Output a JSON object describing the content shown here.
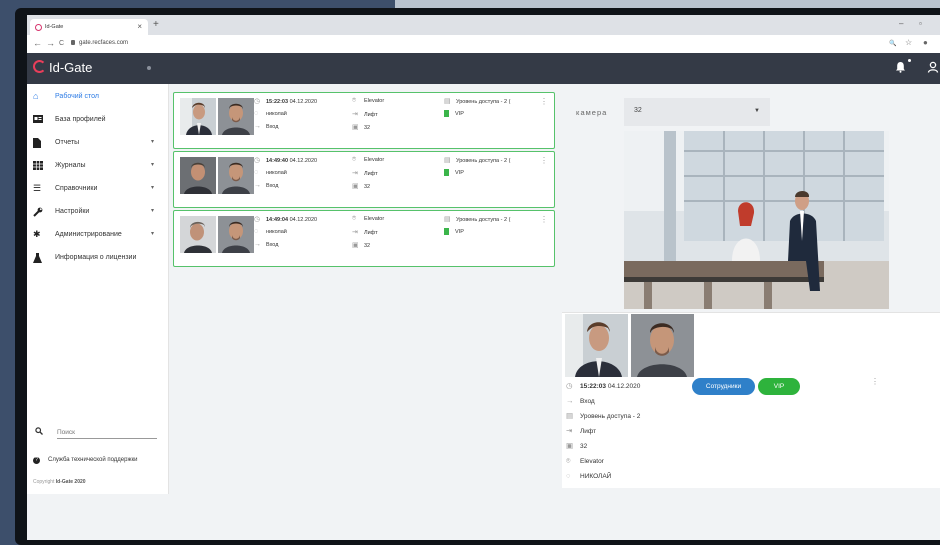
{
  "browser": {
    "tab_title": "Id-Gate",
    "tab_close": "×",
    "new_tab": "+",
    "url": "gate.recfaces.com",
    "nav_back": "←",
    "nav_forward": "→",
    "nav_reload": "C",
    "win_min": "–",
    "win_max": "▫",
    "zoom_icon": "🔍",
    "star_icon": "☆",
    "profile_icon": "●"
  },
  "header": {
    "app_name": "Id-Gate"
  },
  "sidebar": {
    "items": [
      {
        "label": "Рабочий стол",
        "icon": "home-icon",
        "active": true,
        "chevron": ""
      },
      {
        "label": "База профилей",
        "icon": "id-card-icon",
        "active": false,
        "chevron": ""
      },
      {
        "label": "Отчеты",
        "icon": "document-icon",
        "active": false,
        "chevron": "▾"
      },
      {
        "label": "Журналы",
        "icon": "table-icon",
        "active": false,
        "chevron": "▾"
      },
      {
        "label": "Справочники",
        "icon": "list-icon",
        "active": false,
        "chevron": "▾"
      },
      {
        "label": "Настройки",
        "icon": "wrench-icon",
        "active": false,
        "chevron": "▾"
      },
      {
        "label": "Администрирование",
        "icon": "gear-icon",
        "active": false,
        "chevron": "▾"
      },
      {
        "label": "Информация о лицензии",
        "icon": "flask-icon",
        "active": false,
        "chevron": ""
      }
    ],
    "search_placeholder": "Поиск",
    "support_label": "Служба технической поддержки",
    "copyright_prefix": "Copyright",
    "copyright_brand": "Id-Gate 2020"
  },
  "events": [
    {
      "time": "15:22:03",
      "date": "04.12.2020",
      "person": "николай",
      "direction": "Вход",
      "zone": "Elevator",
      "gate": "Лифт",
      "camera": "32",
      "access": "Уровень доступа - 2 (",
      "group": "VIP"
    },
    {
      "time": "14:49:40",
      "date": "04.12.2020",
      "person": "николай",
      "direction": "Вход",
      "zone": "Elevator",
      "gate": "Лифт",
      "camera": "32",
      "access": "Уровень доступа - 2 (",
      "group": "VIP"
    },
    {
      "time": "14:49:04",
      "date": "04.12.2020",
      "person": "николай",
      "direction": "Вход",
      "zone": "Elevator",
      "gate": "Лифт",
      "camera": "32",
      "access": "Уровень доступа - 2 (",
      "group": "VIP"
    }
  ],
  "camera": {
    "label": "камера",
    "selected": "32"
  },
  "detail": {
    "time": "15:22:03",
    "date": "04.12.2020",
    "direction": "Вход",
    "access": "Уровень доступа - 2",
    "gate": "Лифт",
    "camera": "32",
    "zone": "Elevator",
    "person": "НИКОЛАЙ",
    "tags": [
      {
        "label": "Сотрудники",
        "color": "#2f80c9"
      },
      {
        "label": "VIP",
        "color": "#2eb33c"
      }
    ]
  },
  "colors": {
    "accent": "#2c7be5",
    "border_green": "#56c26b",
    "header_bg": "#343a46",
    "logo_red": "#e83e5a"
  }
}
